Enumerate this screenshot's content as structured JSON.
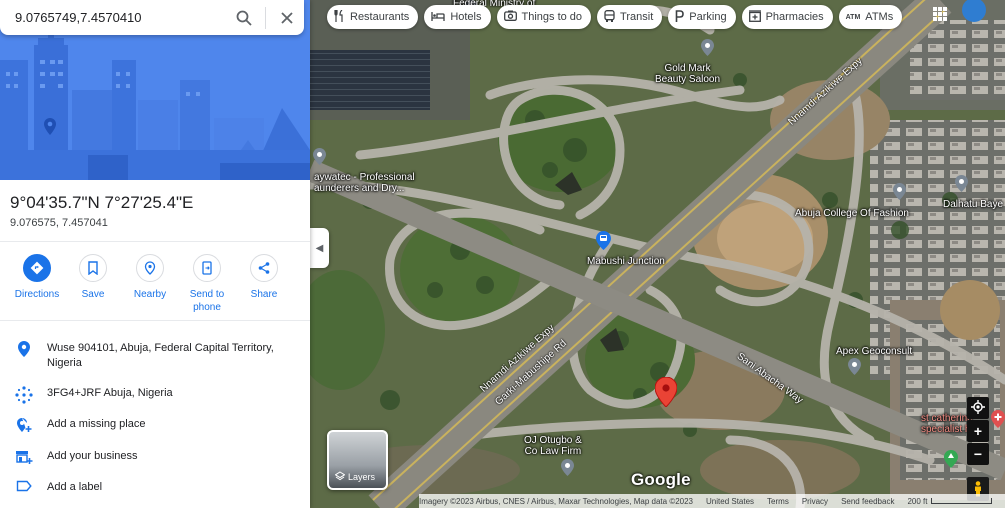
{
  "search": {
    "value": "9.0765749,7.4570410"
  },
  "place": {
    "coords_dms": "9°04'35.7\"N 7°27'25.4\"E",
    "coords_decimal": "9.076575, 7.457041"
  },
  "actions": [
    {
      "label": "Directions",
      "icon": "directions-icon"
    },
    {
      "label": "Save",
      "icon": "bookmark-icon"
    },
    {
      "label": "Nearby",
      "icon": "nearby-icon"
    },
    {
      "label": "Send to phone",
      "icon": "send-to-phone-icon"
    },
    {
      "label": "Share",
      "icon": "share-icon"
    }
  ],
  "info": {
    "address": "Wuse 904101, Abuja, Federal Capital Territory, Nigeria",
    "plus_code": "3FG4+JRF Abuja, Nigeria",
    "add_missing_place": "Add a missing place",
    "add_business": "Add your business",
    "add_label": "Add a label"
  },
  "chips": [
    {
      "label": "Restaurants",
      "icon": "fork-knife-icon"
    },
    {
      "label": "Hotels",
      "icon": "bed-icon"
    },
    {
      "label": "Things to do",
      "icon": "camera-icon"
    },
    {
      "label": "Transit",
      "icon": "bus-icon"
    },
    {
      "label": "Parking",
      "icon": "parking-icon"
    },
    {
      "label": "Pharmacies",
      "icon": "pharmacy-icon"
    },
    {
      "label": "ATMs",
      "icon": "atm-icon"
    }
  ],
  "map_labels": {
    "federal_ministry": "Federal Ministry of",
    "gold_mark": "Gold Mark\nBeauty Saloon",
    "laundry": "aywatec - Professional\naunderers and Dry...",
    "abuja_college": "Abuja College Of Fashion",
    "dalhatu": "Dalhatu Baye",
    "mabushi": "Mabushi Junction",
    "apex": "Apex Geoconsult",
    "specialist": "st catherine\nspecialist hos",
    "oj_otugbo": "OJ Otugbo &\nCo Law Firm",
    "road_nnamdi_top": "Nnamdi Azikiwe Expy",
    "road_nnamdi_bottom": "Nnamdi Azikiwe Expy",
    "road_garki": "Garki-Mabushipe Rd",
    "road_sani": "Sani Abacha Way"
  },
  "layers_label": "Layers",
  "google_logo": "Google",
  "footer": {
    "imagery": "Imagery ©2023 Airbus, CNES / Airbus, Maxar Technologies, Map data ©2023",
    "country": "United States",
    "terms": "Terms",
    "privacy": "Privacy",
    "feedback": "Send feedback",
    "scale": "200 ft"
  },
  "colors": {
    "accent": "#1a73e8",
    "hero": "#4f86ec",
    "pin": "#ea4335"
  }
}
